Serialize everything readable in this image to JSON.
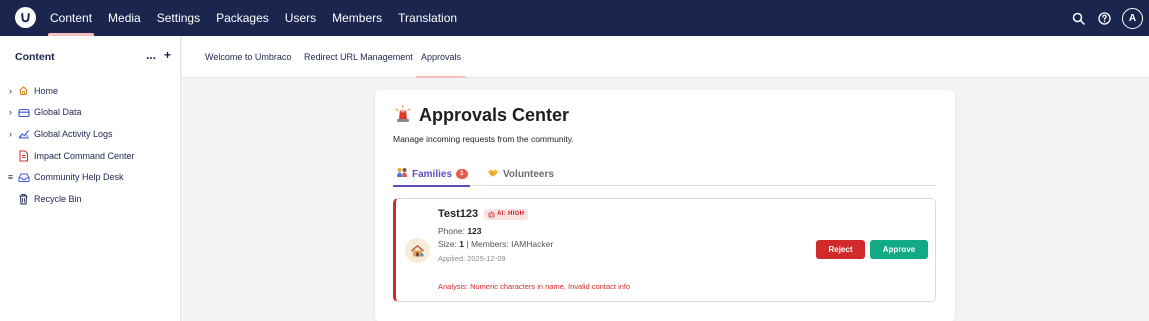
{
  "header": {
    "logo_icon": "umbraco-logo-icon",
    "nav": [
      {
        "label": "Content",
        "active": true
      },
      {
        "label": "Media"
      },
      {
        "label": "Settings"
      },
      {
        "label": "Packages"
      },
      {
        "label": "Users"
      },
      {
        "label": "Members"
      },
      {
        "label": "Translation"
      }
    ],
    "avatar_initial": "A"
  },
  "sidebar": {
    "title": "Content",
    "more_label": "...",
    "add_label": "+",
    "items": [
      {
        "label": "Home",
        "icon": "home-icon",
        "caret": "›"
      },
      {
        "label": "Global Data",
        "icon": "folder-icon",
        "caret": "›"
      },
      {
        "label": "Global Activity Logs",
        "icon": "chart-icon",
        "caret": "›"
      },
      {
        "label": "Impact Command Center",
        "icon": "document-icon",
        "caret": ""
      },
      {
        "label": "Community Help Desk",
        "icon": "inbox-icon",
        "caret": "≡"
      },
      {
        "label": "Recycle Bin",
        "icon": "trash-icon",
        "caret": ""
      }
    ]
  },
  "content_tabs": [
    {
      "label": "Welcome to Umbraco"
    },
    {
      "label": "Redirect URL Management"
    },
    {
      "label": "Approvals",
      "active": true
    }
  ],
  "card": {
    "title": "Approvals Center",
    "subtitle": "Manage incoming requests from the community.",
    "tabs": [
      {
        "label": "Families",
        "count": "1",
        "active": true
      },
      {
        "label": "Volunteers"
      }
    ],
    "request": {
      "name": "Test123",
      "ai_badge": "AI: HIGH",
      "phone_label": "Phone:",
      "phone_value": "123",
      "size_label": "Size:",
      "size_value": "1",
      "members_label": "| Members:",
      "members_value": "IAMHacker",
      "applied": "Applied: 2025-12-09",
      "analysis": "Analysis: Numeric characters in name, Invalid contact info",
      "reject_label": "Reject",
      "approve_label": "Approve"
    }
  },
  "colors": {
    "header_bg": "#1b264f",
    "active_accent": "#f5c1bc",
    "tab_active": "#5b4fc2",
    "reject": "#d22a2a",
    "approve": "#12a985"
  }
}
